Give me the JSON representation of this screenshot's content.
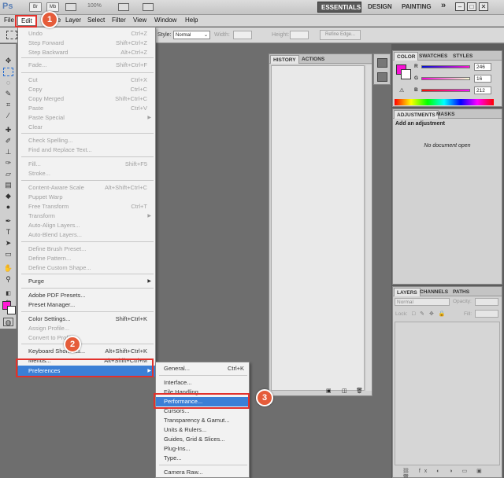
{
  "appbar": {
    "logo": "Ps",
    "icons": [
      "Br",
      "Mb"
    ],
    "zoom": "100%",
    "workspaces": [
      "ESSENTIALS",
      "DESIGN",
      "PAINTING"
    ],
    "more": "»",
    "window_controls": [
      "–",
      "□",
      "✕"
    ]
  },
  "menubar": [
    "File",
    "Edit",
    "Image",
    "Layer",
    "Select",
    "Filter",
    "View",
    "Window",
    "Help"
  ],
  "options": {
    "style_label": "Style:",
    "style_value": "Normal",
    "width_label": "Width:",
    "height_label": "Height:",
    "refine_edge": "Refine Edge..."
  },
  "edit_menu": [
    {
      "label": "Undo",
      "shortcut": "Ctrl+Z",
      "disabled": true
    },
    {
      "label": "Step Forward",
      "shortcut": "Shift+Ctrl+Z",
      "disabled": true
    },
    {
      "label": "Step Backward",
      "shortcut": "Alt+Ctrl+Z",
      "disabled": true
    },
    {
      "label": "Fade...",
      "shortcut": "Shift+Ctrl+F",
      "disabled": true
    },
    {
      "label": "Cut",
      "shortcut": "Ctrl+X",
      "disabled": true
    },
    {
      "label": "Copy",
      "shortcut": "Ctrl+C",
      "disabled": true
    },
    {
      "label": "Copy Merged",
      "shortcut": "Shift+Ctrl+C",
      "disabled": true
    },
    {
      "label": "Paste",
      "shortcut": "Ctrl+V",
      "disabled": true
    },
    {
      "label": "Paste Special",
      "shortcut": "",
      "disabled": true,
      "submenu": true
    },
    {
      "label": "Clear",
      "shortcut": "",
      "disabled": true
    },
    {
      "label": "Check Spelling...",
      "shortcut": "",
      "disabled": true
    },
    {
      "label": "Find and Replace Text...",
      "shortcut": "",
      "disabled": true
    },
    {
      "label": "Fill...",
      "shortcut": "Shift+F5",
      "disabled": true
    },
    {
      "label": "Stroke...",
      "shortcut": "",
      "disabled": true
    },
    {
      "label": "Content-Aware Scale",
      "shortcut": "Alt+Shift+Ctrl+C",
      "disabled": true
    },
    {
      "label": "Puppet Warp",
      "shortcut": "",
      "disabled": true
    },
    {
      "label": "Free Transform",
      "shortcut": "Ctrl+T",
      "disabled": true
    },
    {
      "label": "Transform",
      "shortcut": "",
      "disabled": true,
      "submenu": true
    },
    {
      "label": "Auto-Align Layers...",
      "shortcut": "",
      "disabled": true
    },
    {
      "label": "Auto-Blend Layers...",
      "shortcut": "",
      "disabled": true
    },
    {
      "label": "Define Brush Preset...",
      "shortcut": "",
      "disabled": true
    },
    {
      "label": "Define Pattern...",
      "shortcut": "",
      "disabled": true
    },
    {
      "label": "Define Custom Shape...",
      "shortcut": "",
      "disabled": true
    },
    {
      "label": "Purge",
      "shortcut": "",
      "disabled": false,
      "submenu": true
    },
    {
      "label": "Adobe PDF Presets...",
      "shortcut": "",
      "disabled": false
    },
    {
      "label": "Preset Manager...",
      "shortcut": "",
      "disabled": false
    },
    {
      "label": "Color Settings...",
      "shortcut": "Shift+Ctrl+K",
      "disabled": false
    },
    {
      "label": "Assign Profile...",
      "shortcut": "",
      "disabled": true
    },
    {
      "label": "Convert to Profile...",
      "shortcut": "",
      "disabled": true
    },
    {
      "label": "Keyboard Shortcuts...",
      "shortcut": "Alt+Shift+Ctrl+K",
      "disabled": false
    },
    {
      "label": "Menus...",
      "shortcut": "Alt+Shift+Ctrl+M",
      "disabled": false
    },
    {
      "label": "Preferences",
      "shortcut": "",
      "disabled": false,
      "submenu": true
    }
  ],
  "prefs_menu": [
    {
      "label": "General...",
      "shortcut": "Ctrl+K"
    },
    {
      "label": "Interface...",
      "shortcut": ""
    },
    {
      "label": "File Handling...",
      "shortcut": ""
    },
    {
      "label": "Performance...",
      "shortcut": ""
    },
    {
      "label": "Cursors...",
      "shortcut": ""
    },
    {
      "label": "Transparency & Gamut...",
      "shortcut": ""
    },
    {
      "label": "Units & Rulers...",
      "shortcut": ""
    },
    {
      "label": "Guides, Grid & Slices...",
      "shortcut": ""
    },
    {
      "label": "Plug-Ins...",
      "shortcut": ""
    },
    {
      "label": "Type...",
      "shortcut": ""
    },
    {
      "label": "Camera Raw...",
      "shortcut": ""
    }
  ],
  "history_panel": {
    "tabs": [
      "HISTORY",
      "ACTIONS"
    ]
  },
  "color_panel": {
    "tabs": [
      "COLOR",
      "SWATCHES",
      "STYLES"
    ],
    "channels": [
      {
        "label": "R",
        "value": "246"
      },
      {
        "label": "G",
        "value": "16"
      },
      {
        "label": "B",
        "value": "212"
      }
    ],
    "fg_color": "#f610d4"
  },
  "adjustments_panel": {
    "tabs": [
      "ADJUSTMENTS",
      "MASKS"
    ],
    "heading": "Add an adjustment",
    "empty_text": "No document open"
  },
  "layers_panel": {
    "tabs": [
      "LAYERS",
      "CHANNELS",
      "PATHS"
    ],
    "blend_mode": "Normal",
    "opacity_label": "Opacity:",
    "lock_label": "Lock:",
    "fill_label": "Fill:"
  },
  "callouts": [
    "1",
    "2",
    "3"
  ]
}
